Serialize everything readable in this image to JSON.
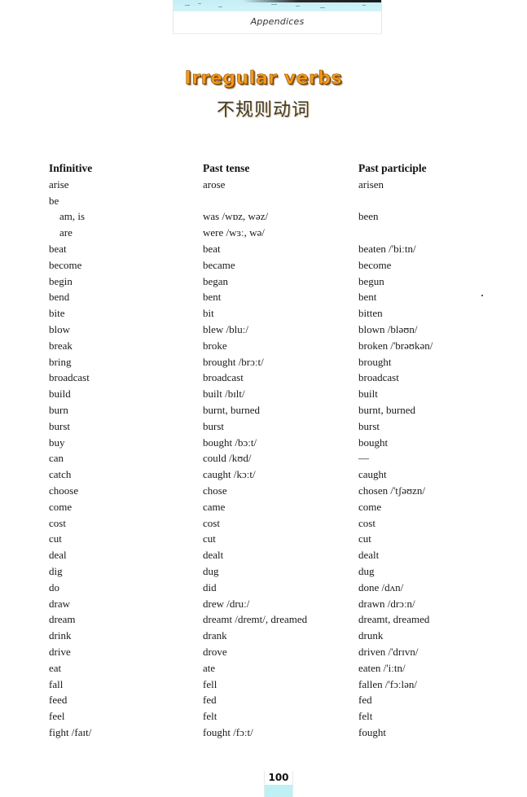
{
  "header": {
    "section": "Appendices"
  },
  "title": {
    "english": "Irregular verbs",
    "chinese": "不规则动词",
    "accent_color": "#f29a1b"
  },
  "table": {
    "columns": [
      "Infinitive",
      "Past tense",
      "Past participle"
    ],
    "rows": [
      {
        "infinitive": "arise",
        "past": "arose",
        "participle": "arisen",
        "indent": false
      },
      {
        "infinitive": "be",
        "past": "",
        "participle": "",
        "indent": false
      },
      {
        "infinitive": "am, is",
        "past": "was /wɒz, wəz/",
        "participle": "been",
        "indent": true
      },
      {
        "infinitive": "are",
        "past": "were /wɜː, wə/",
        "participle": "",
        "indent": true
      },
      {
        "infinitive": "beat",
        "past": "beat",
        "participle": "beaten /'biːtn/",
        "indent": false
      },
      {
        "infinitive": "become",
        "past": "became",
        "participle": "become",
        "indent": false
      },
      {
        "infinitive": "begin",
        "past": "began",
        "participle": "begun",
        "indent": false
      },
      {
        "infinitive": "bend",
        "past": "bent",
        "participle": "bent",
        "indent": false
      },
      {
        "infinitive": "bite",
        "past": "bit",
        "participle": "bitten",
        "indent": false
      },
      {
        "infinitive": "blow",
        "past": "blew /bluː/",
        "participle": "blown /bləʊn/",
        "indent": false
      },
      {
        "infinitive": "break",
        "past": "broke",
        "participle": "broken /'brəʊkən/",
        "indent": false
      },
      {
        "infinitive": "bring",
        "past": "brought /brɔːt/",
        "participle": "brought",
        "indent": false
      },
      {
        "infinitive": "broadcast",
        "past": "broadcast",
        "participle": "broadcast",
        "indent": false
      },
      {
        "infinitive": "build",
        "past": "built /bɪlt/",
        "participle": "built",
        "indent": false
      },
      {
        "infinitive": "burn",
        "past": "burnt, burned",
        "participle": "burnt, burned",
        "indent": false
      },
      {
        "infinitive": "burst",
        "past": "burst",
        "participle": "burst",
        "indent": false
      },
      {
        "infinitive": "buy",
        "past": "bought /bɔːt/",
        "participle": "bought",
        "indent": false
      },
      {
        "infinitive": "can",
        "past": "could /kʊd/",
        "participle": "—",
        "indent": false
      },
      {
        "infinitive": "catch",
        "past": "caught /kɔːt/",
        "participle": "caught",
        "indent": false
      },
      {
        "infinitive": "choose",
        "past": "chose",
        "participle": "chosen /'tʃəʊzn/",
        "indent": false
      },
      {
        "infinitive": "come",
        "past": "came",
        "participle": "come",
        "indent": false
      },
      {
        "infinitive": "cost",
        "past": "cost",
        "participle": "cost",
        "indent": false
      },
      {
        "infinitive": "cut",
        "past": "cut",
        "participle": "cut",
        "indent": false
      },
      {
        "infinitive": "deal",
        "past": "dealt",
        "participle": "dealt",
        "indent": false
      },
      {
        "infinitive": "dig",
        "past": "dug",
        "participle": "dug",
        "indent": false
      },
      {
        "infinitive": "do",
        "past": "did",
        "participle": "done /dʌn/",
        "indent": false
      },
      {
        "infinitive": "draw",
        "past": "drew /druː/",
        "participle": "drawn /drɔːn/",
        "indent": false
      },
      {
        "infinitive": "dream",
        "past": "dreamt /dremt/, dreamed",
        "participle": "dreamt, dreamed",
        "indent": false
      },
      {
        "infinitive": "drink",
        "past": "drank",
        "participle": "drunk",
        "indent": false
      },
      {
        "infinitive": "drive",
        "past": "drove",
        "participle": "driven /'drɪvn/",
        "indent": false
      },
      {
        "infinitive": "eat",
        "past": "ate",
        "participle": "eaten /'iːtn/",
        "indent": false
      },
      {
        "infinitive": "fall",
        "past": "fell",
        "participle": "fallen /'fɔːlən/",
        "indent": false
      },
      {
        "infinitive": "feed",
        "past": "fed",
        "participle": "fed",
        "indent": false
      },
      {
        "infinitive": "feel",
        "past": "felt",
        "participle": "felt",
        "indent": false
      },
      {
        "infinitive": "fight /faɪt/",
        "past": "fought /fɔːt/",
        "participle": "fought",
        "indent": false
      }
    ]
  },
  "footer": {
    "page_number": "100"
  }
}
